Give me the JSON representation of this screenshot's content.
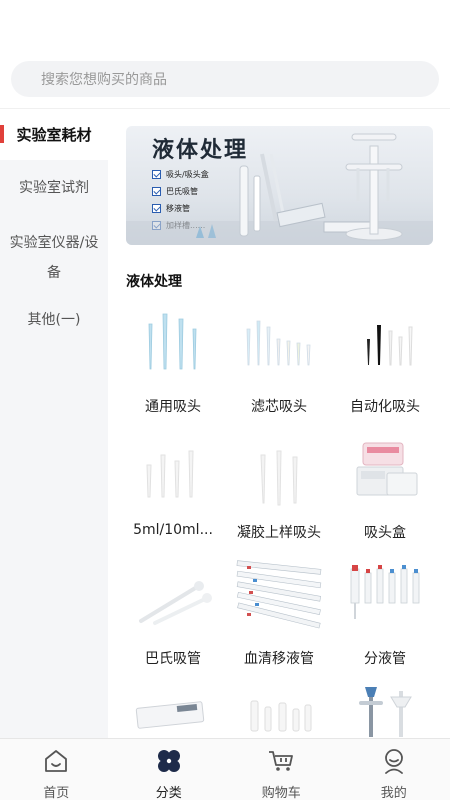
{
  "search": {
    "placeholder": "搜索您想购买的商品"
  },
  "sidebar": {
    "items": [
      {
        "label": "实验室耗材",
        "active": true
      },
      {
        "label": "实验室试剂",
        "active": false
      },
      {
        "label": "实验室仪器/设备",
        "active": false
      },
      {
        "label": "其他(一)",
        "active": false
      }
    ]
  },
  "banner": {
    "title": "液体处理",
    "items": [
      "吸头/吸头盒",
      "巴氏吸管",
      "移液管",
      "加样槽......"
    ]
  },
  "section": {
    "title": "液体处理"
  },
  "products": [
    {
      "label": "通用吸头",
      "icon": "tips-blue-icon"
    },
    {
      "label": "滤芯吸头",
      "icon": "filter-tips-icon"
    },
    {
      "label": "自动化吸头",
      "icon": "auto-tips-icon"
    },
    {
      "label": "5ml/10ml...",
      "icon": "large-tips-icon"
    },
    {
      "label": "凝胶上样吸头",
      "icon": "gel-tips-icon"
    },
    {
      "label": "吸头盒",
      "icon": "tip-box-icon"
    },
    {
      "label": "巴氏吸管",
      "icon": "pasteur-pipette-icon"
    },
    {
      "label": "血清移液管",
      "icon": "serological-pipette-icon"
    },
    {
      "label": "分液管",
      "icon": "dispenser-icon"
    },
    {
      "label": "",
      "icon": "reservoir-icon"
    },
    {
      "label": "",
      "icon": "tubes-icon"
    },
    {
      "label": "",
      "icon": "stand-icon"
    }
  ],
  "tabbar": {
    "tabs": [
      {
        "label": "首页",
        "icon": "home-icon"
      },
      {
        "label": "分类",
        "icon": "category-icon",
        "active": true
      },
      {
        "label": "购物车",
        "icon": "cart-icon"
      },
      {
        "label": "我的",
        "icon": "profile-icon"
      }
    ]
  },
  "colors": {
    "accent": "#e0403a",
    "active_icon": "#1e2b4a"
  }
}
